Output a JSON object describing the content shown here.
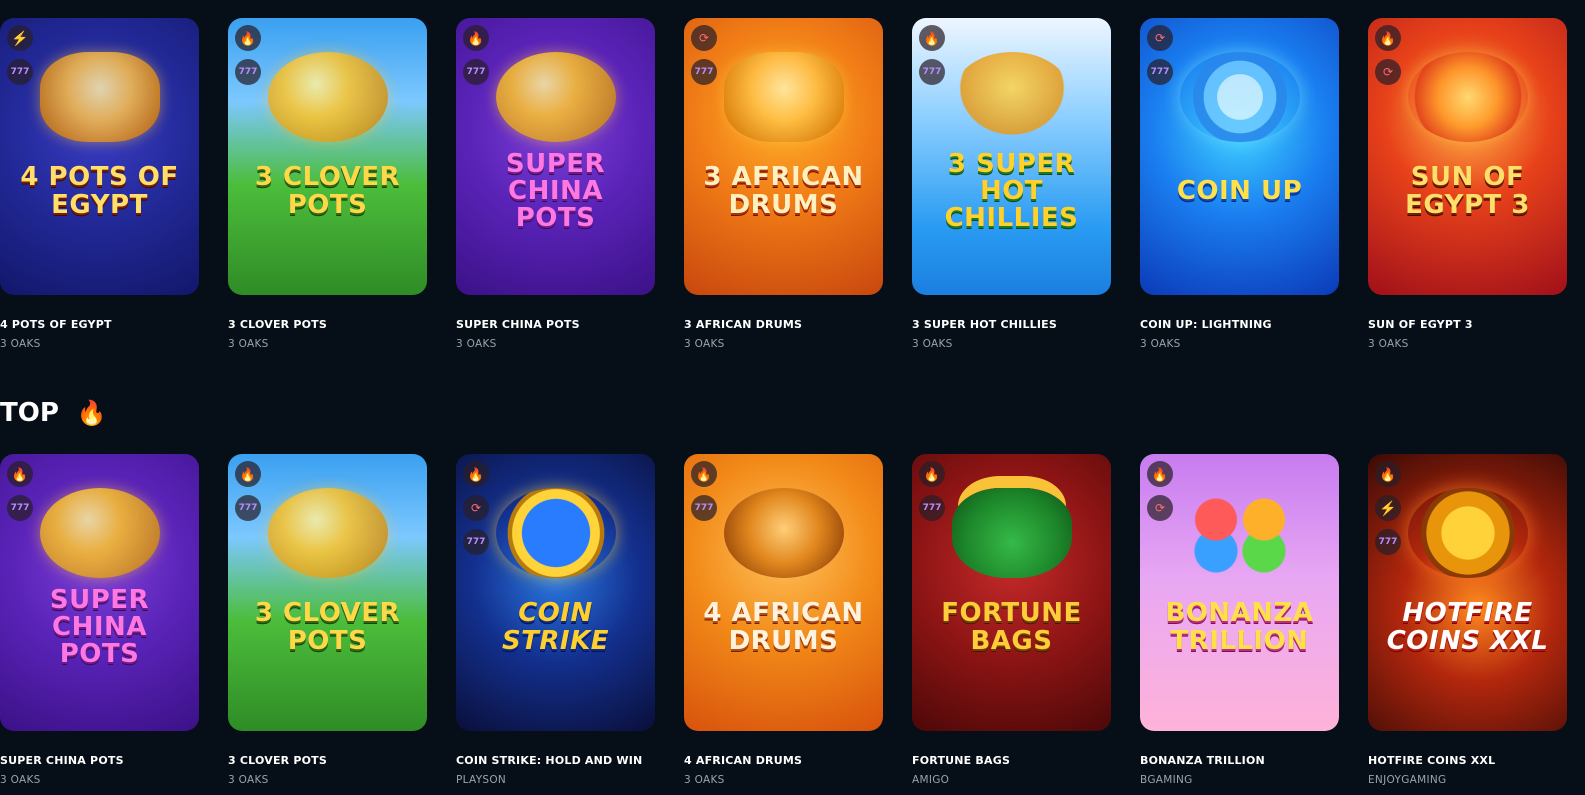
{
  "section_top": {
    "title": "TOP"
  },
  "row1": [
    {
      "name": "4 POTS OF EGYPT",
      "provider": "3 OAKS",
      "art_text": "4 POTS OF EGYPT",
      "badges": [
        "lightning-icon",
        "slot-777-icon"
      ]
    },
    {
      "name": "3 CLOVER POTS",
      "provider": "3 OAKS",
      "art_text": "3 CLOVER POTS",
      "badges": [
        "fire-icon",
        "slot-777-icon"
      ]
    },
    {
      "name": "SUPER CHINA POTS",
      "provider": "3 OAKS",
      "art_text": "SUPER CHINA POTS",
      "badges": [
        "fire-icon",
        "slot-777-icon"
      ]
    },
    {
      "name": "3 AFRICAN DRUMS",
      "provider": "3 OAKS",
      "art_text": "3 AFRICAN DRUMS",
      "badges": [
        "buy-feature-icon",
        "slot-777-icon"
      ]
    },
    {
      "name": "3 SUPER HOT CHILLIES",
      "provider": "3 OAKS",
      "art_text": "3 SUPER HOT CHILLIES",
      "badges": [
        "fire-icon",
        "slot-777-icon"
      ]
    },
    {
      "name": "COIN UP: LIGHTNING",
      "provider": "3 OAKS",
      "art_text": "COIN UP",
      "badges": [
        "buy-feature-icon",
        "slot-777-icon"
      ]
    },
    {
      "name": "SUN OF EGYPT 3",
      "provider": "3 OAKS",
      "art_text": "SUN OF EGYPT 3",
      "badges": [
        "fire-icon",
        "buy-feature-icon"
      ]
    }
  ],
  "row2": [
    {
      "name": "SUPER CHINA POTS",
      "provider": "3 OAKS",
      "art_text": "SUPER CHINA POTS",
      "badges": [
        "fire-icon",
        "slot-777-icon"
      ]
    },
    {
      "name": "3 CLOVER POTS",
      "provider": "3 OAKS",
      "art_text": "3 CLOVER POTS",
      "badges": [
        "fire-icon",
        "slot-777-icon"
      ]
    },
    {
      "name": "COIN STRIKE: HOLD AND WIN",
      "provider": "PLAYSON",
      "art_text": "COIN STRIKE",
      "badges": [
        "fire-icon",
        "buy-feature-icon",
        "slot-777-icon"
      ]
    },
    {
      "name": "4 AFRICAN DRUMS",
      "provider": "3 OAKS",
      "art_text": "4 AFRICAN DRUMS",
      "badges": [
        "fire-icon",
        "slot-777-icon"
      ]
    },
    {
      "name": "FORTUNE BAGS",
      "provider": "AMIGO",
      "art_text": "FORTUNE BAGS",
      "badges": [
        "fire-icon",
        "slot-777-icon"
      ]
    },
    {
      "name": "BONANZA TRILLION",
      "provider": "BGAMING",
      "art_text": "BONANZA TRILLION",
      "badges": [
        "fire-icon",
        "buy-feature-icon"
      ]
    },
    {
      "name": "HOTFIRE COINS XXL",
      "provider": "ENJOYGAMING",
      "art_text": "HOTFIRE COINS XXL",
      "badges": [
        "fire-icon",
        "lightning-icon",
        "slot-777-icon"
      ]
    }
  ],
  "colors": {
    "background": "#060f17",
    "provider_text": "#9aa3ad",
    "fire": "#ff7a1a",
    "lightning": "#1fe08a",
    "slot": "#b88cff"
  }
}
